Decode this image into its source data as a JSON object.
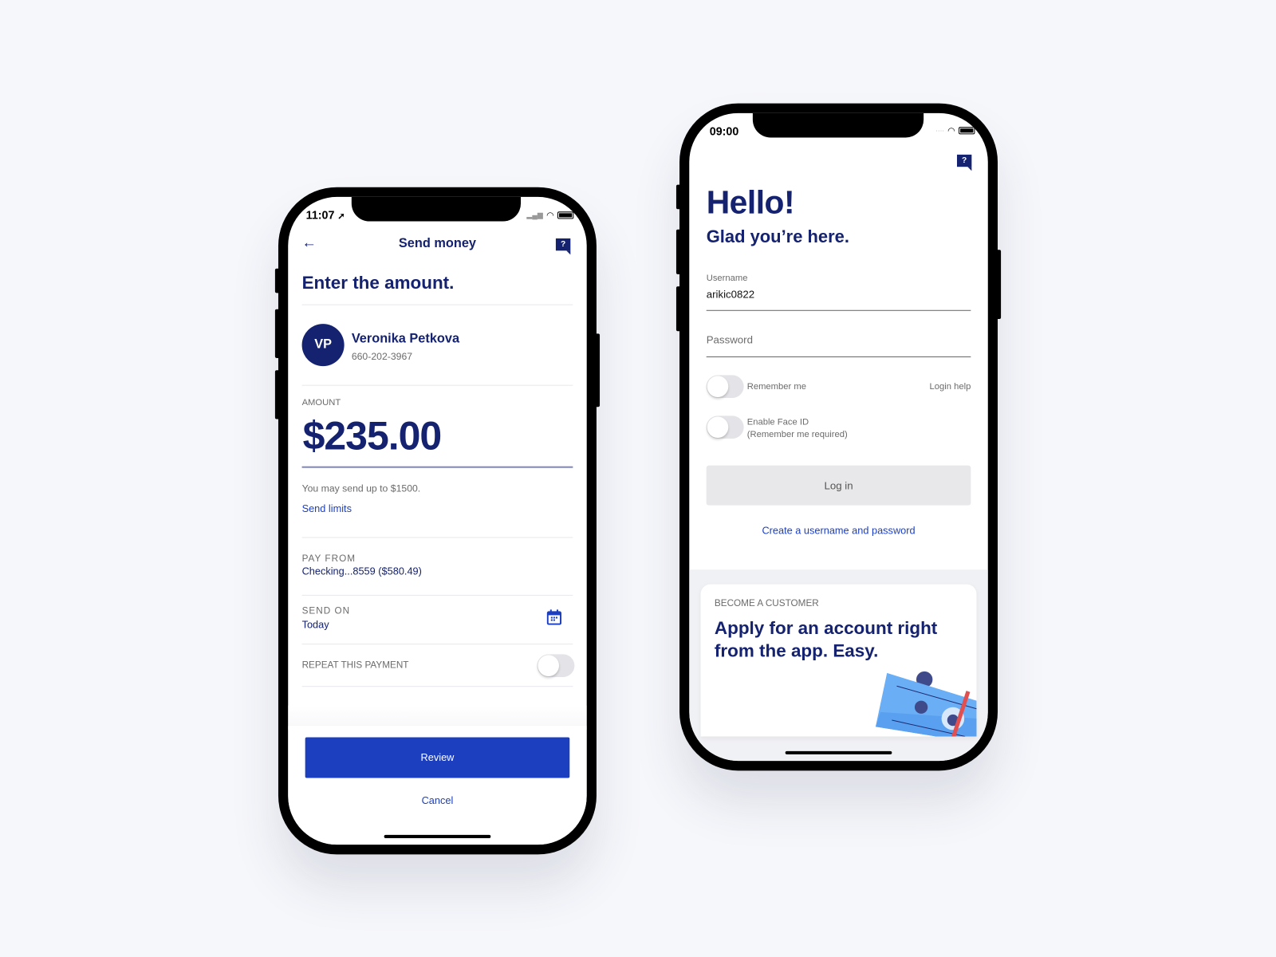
{
  "send_money_screen": {
    "status_time": "11:07",
    "header_title": "Send money",
    "heading": "Enter the amount.",
    "recipient": {
      "initials": "VP",
      "name": "Veronika Petkova",
      "phone": "660-202-3967"
    },
    "amount_label": "AMOUNT",
    "amount_value": "$235.00",
    "limit_text": "You may send up to $1500.",
    "send_limits_link": "Send limits",
    "pay_from_label": "PAY FROM",
    "pay_from_value": "Checking...8559 ($580.49)",
    "send_on_label": "SEND ON",
    "send_on_value": "Today",
    "repeat_label": "REPEAT THIS PAYMENT",
    "repeat_enabled": false,
    "review_button": "Review",
    "cancel_link": "Cancel",
    "help_glyph": "?"
  },
  "login_screen": {
    "status_time": "09:00",
    "help_glyph": "?",
    "title": "Hello!",
    "subtitle": "Glad you’re here.",
    "username_label": "Username",
    "username_value": "arikic0822",
    "password_placeholder": "Password",
    "remember_me_label": "Remember me",
    "remember_me_enabled": false,
    "login_help_link": "Login help",
    "face_id_label": "Enable Face ID",
    "face_id_note": "(Remember me required)",
    "face_id_enabled": false,
    "login_button": "Log in",
    "create_account_link": "Create a username and password",
    "promo": {
      "eyebrow": "BECOME A CUSTOMER",
      "headline_line1": "Apply for an account right",
      "headline_line2": "from the app. Easy."
    }
  },
  "colors": {
    "navy": "#142270",
    "accent_blue": "#1c3fbf",
    "background": "#f6f7fb"
  }
}
